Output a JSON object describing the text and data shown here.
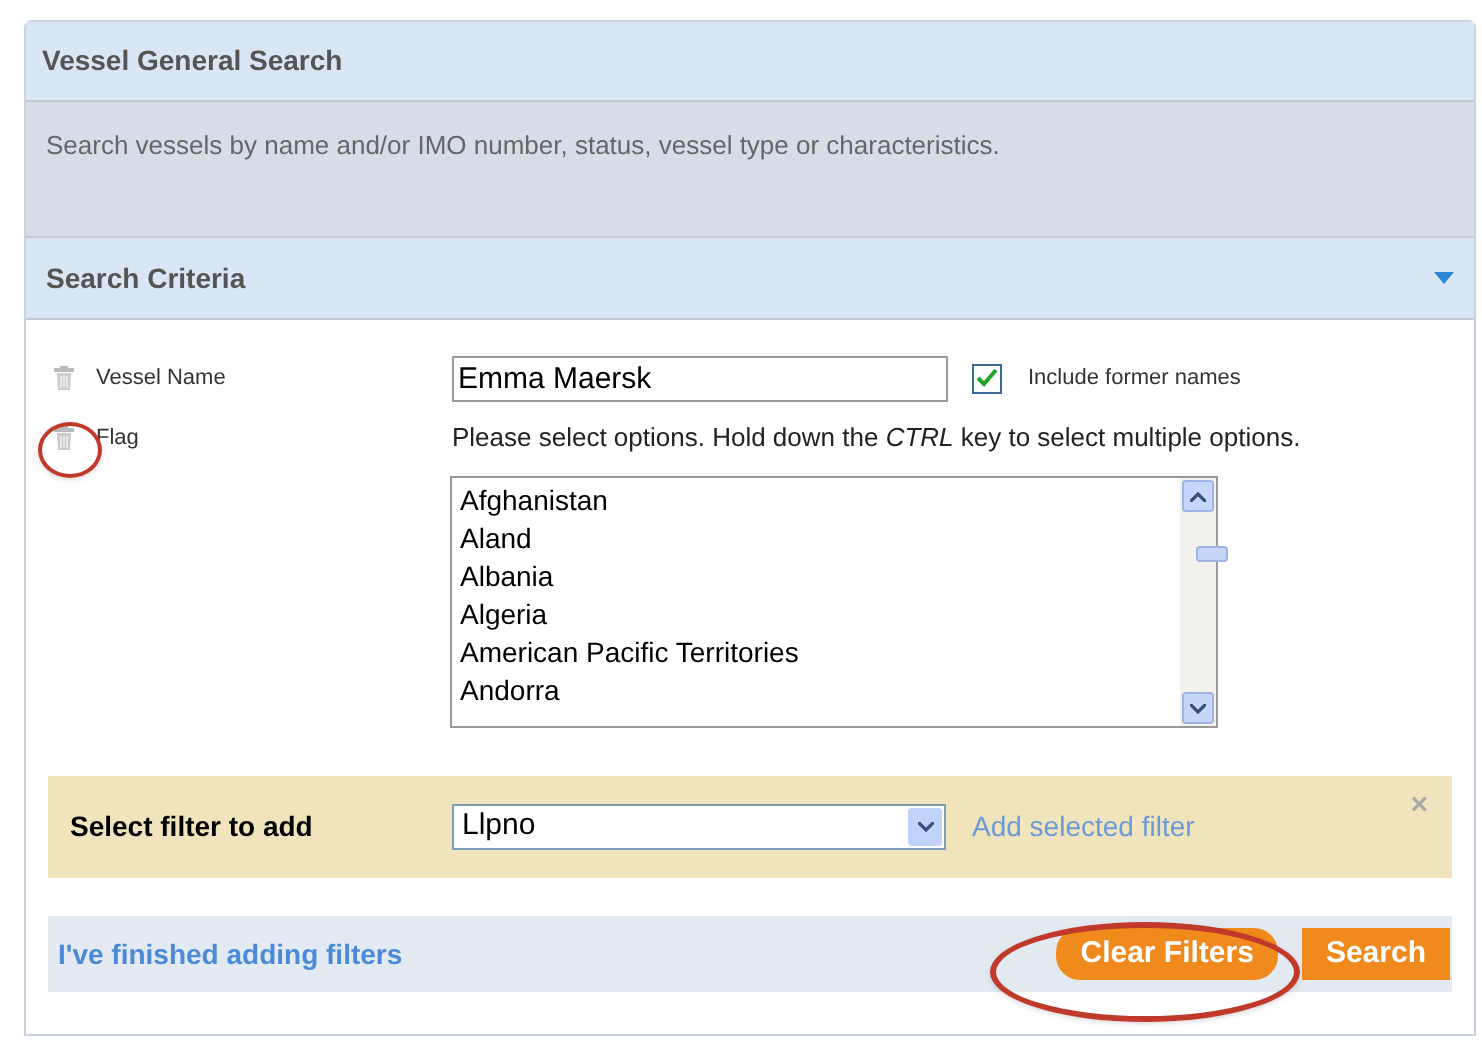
{
  "header": {
    "title": "Vessel General Search",
    "description": "Search vessels by name and/or IMO number, status, vessel type or characteristics."
  },
  "criteria": {
    "title": "Search Criteria",
    "expanded": true
  },
  "vessel_name": {
    "label": "Vessel Name",
    "value": "Emma Maersk",
    "include_former": {
      "label": "Include former names",
      "checked": true
    }
  },
  "flag": {
    "label": "Flag",
    "hint": "Please select options. Hold down the *CTRL* key to select multiple options.",
    "options": [
      {
        "label": "Afghanistan",
        "selected": false
      },
      {
        "label": "Aland",
        "selected": false
      },
      {
        "label": "Albania",
        "selected": false
      },
      {
        "label": "Algeria",
        "selected": false
      },
      {
        "label": "American Pacific Territories",
        "selected": false
      },
      {
        "label": "Andorra",
        "selected": false
      }
    ]
  },
  "filter_bar": {
    "label": "Select filter to add",
    "value": "Llpno",
    "link": "Add selected filter",
    "close": "×"
  },
  "footer": {
    "link": "I've finished adding filters",
    "buttons": [
      "Clear Filters",
      "Search"
    ]
  }
}
